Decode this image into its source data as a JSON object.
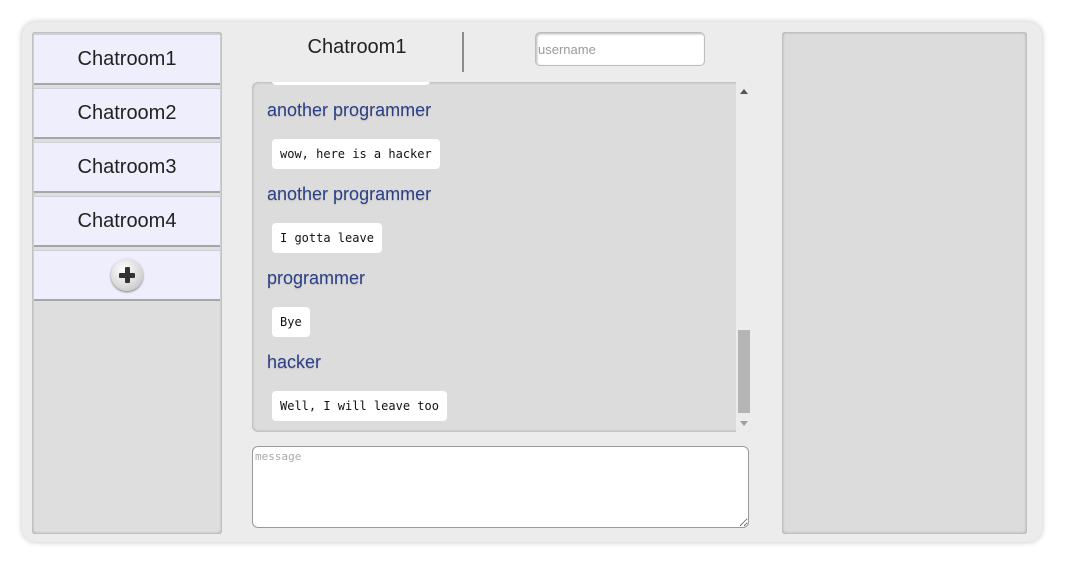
{
  "sidebar": {
    "rooms": [
      {
        "label": "Chatroom1"
      },
      {
        "label": "Chatroom2"
      },
      {
        "label": "Chatroom3"
      },
      {
        "label": "Chatroom4"
      }
    ],
    "add_icon": "plus-circle-icon"
  },
  "header": {
    "room_title": "Chatroom1",
    "username_placeholder": "username"
  },
  "messages": [
    {
      "author": "another programmer",
      "text": "wow, here is a hacker"
    },
    {
      "author": "another programmer",
      "text": "I gotta leave"
    },
    {
      "author": "programmer",
      "text": "Bye"
    },
    {
      "author": "hacker",
      "text": "Well, I will leave too"
    }
  ],
  "composer": {
    "placeholder": "message"
  },
  "colors": {
    "author": "#2b3f86",
    "room_button": "#eeeefc",
    "panel": "#dcdcdc"
  }
}
